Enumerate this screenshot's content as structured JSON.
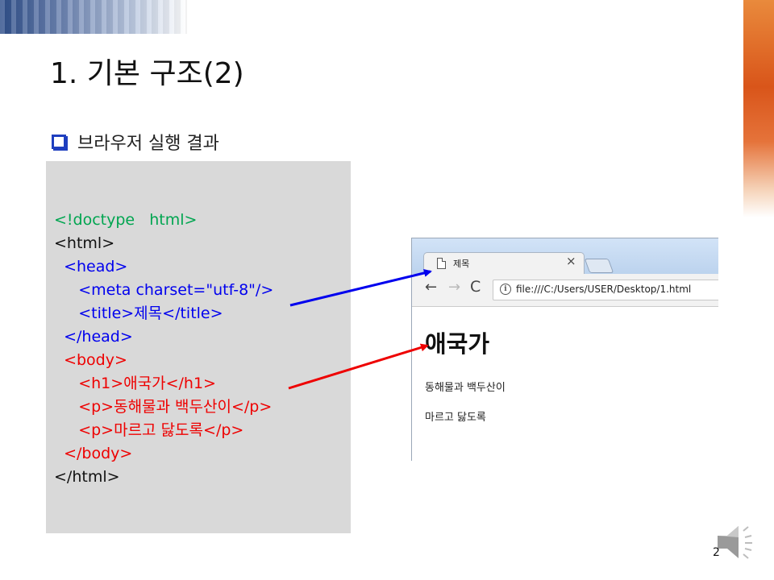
{
  "slide": {
    "title": "1. 기본 구조(2)",
    "bullet": "브라우저 실행 결과",
    "page_number": "2"
  },
  "code_lines": [
    {
      "text": "<!doctype   html>",
      "color": "#00a550"
    },
    {
      "text": "<html>",
      "color": "#111111"
    },
    {
      "text": "  <head>",
      "color": "#0000ee"
    },
    {
      "text": "     <meta charset=\"utf-8\"/>",
      "color": "#0000ee"
    },
    {
      "text": "     <title>제목</title>",
      "color": "#0000ee"
    },
    {
      "text": "  </head>",
      "color": "#0000ee"
    },
    {
      "text": "  <body>",
      "color": "#ee0000"
    },
    {
      "text": "     <h1>애국가</h1>",
      "color": "#ee0000"
    },
    {
      "text": "     <p>동해물과 백두산이</p>",
      "color": "#ee0000"
    },
    {
      "text": "     <p>마르고 닳도록</p>",
      "color": "#ee0000"
    },
    {
      "text": "  </body>",
      "color": "#ee0000"
    },
    {
      "text": "</html>",
      "color": "#111111"
    }
  ],
  "browser": {
    "tab_title": "제목",
    "tab_close": "×",
    "nav": {
      "back": "←",
      "forward": "→",
      "reload": "C"
    },
    "url": "file:///C:/Users/USER/Desktop/1.html",
    "page": {
      "h1": "애국가",
      "p1": "동해물과 백두산이",
      "p2": "마르고 닳도록"
    }
  },
  "colors": {
    "accent_blue": "#0000ee",
    "accent_red": "#ee0000",
    "doctype_green": "#00a550",
    "code_panel_bg": "#d9d9d9"
  },
  "icons": [
    "page-icon",
    "close-icon",
    "back-arrow-icon",
    "forward-arrow-icon",
    "reload-icon",
    "info-icon",
    "speaker-icon",
    "checkbox-bullet-icon"
  ]
}
